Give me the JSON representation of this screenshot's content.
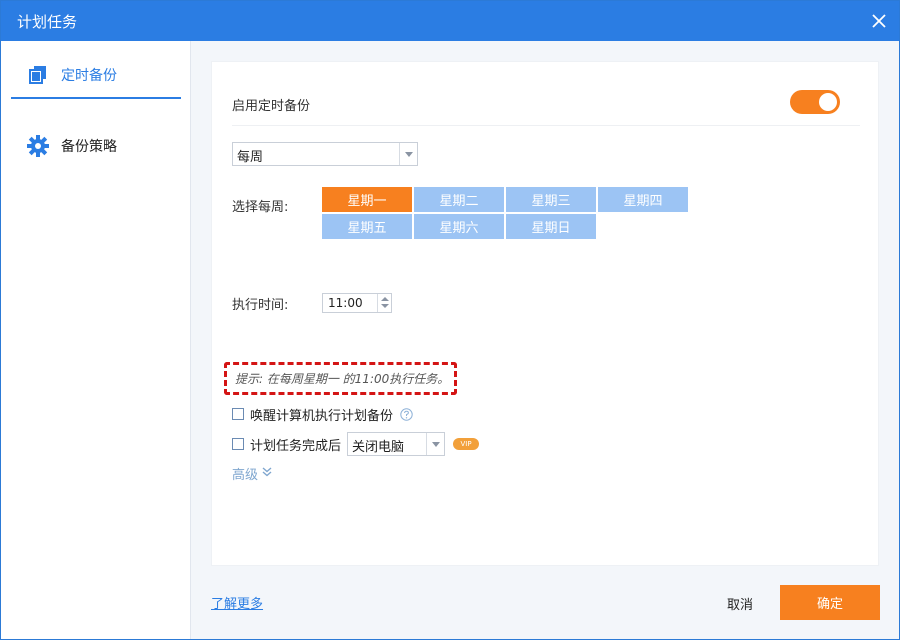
{
  "window": {
    "title": "计划任务"
  },
  "sidebar": {
    "items": [
      {
        "label": "定时备份",
        "icon": "copy-icon",
        "active": true
      },
      {
        "label": "备份策略",
        "icon": "gear-icon",
        "active": false
      }
    ]
  },
  "schedule": {
    "enable_label": "启用定时备份",
    "enabled": true,
    "frequency": "每周",
    "week_label": "选择每周:",
    "days": [
      "星期一",
      "星期二",
      "星期三",
      "星期四",
      "星期五",
      "星期六",
      "星期日"
    ],
    "selected_days": [
      "星期一"
    ],
    "time_label": "执行时间:",
    "time_value": "11:00",
    "hint": "提示: 在每周星期一 的11:00执行任务。",
    "wake_label": "唤醒计算机执行计划备份",
    "after_label": "计划任务完成后",
    "after_value": "关闭电脑",
    "vip_badge": "VIP",
    "advanced_label": "高级"
  },
  "footer": {
    "learn_more": "了解更多",
    "cancel": "取消",
    "ok": "确定"
  },
  "colors": {
    "titlebar": "#2b7de3",
    "accent_orange": "#f7801f",
    "day_unselected": "#9cc4f4",
    "hint_border": "#d41414"
  }
}
